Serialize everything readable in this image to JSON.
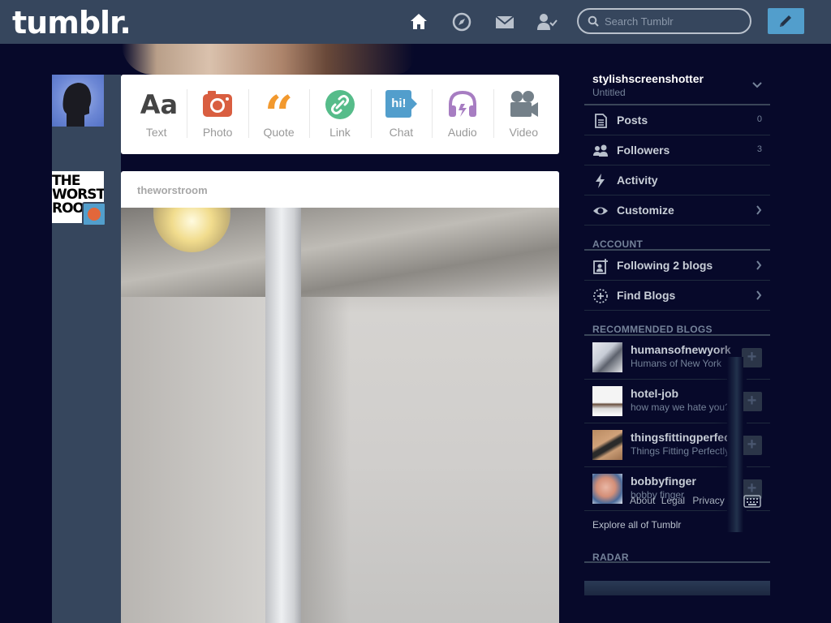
{
  "app": {
    "logo": "tumblr."
  },
  "search": {
    "placeholder": "Search Tumblr"
  },
  "nav": {
    "icons": [
      "home-icon",
      "compass-icon",
      "mail-icon",
      "account-icon"
    ],
    "compose_icon": "pencil-icon"
  },
  "post_types": [
    {
      "label": "Text",
      "glyph": "Aa",
      "color": "#444444"
    },
    {
      "label": "Photo",
      "color": "#d95e40"
    },
    {
      "label": "Quote",
      "glyph": "“",
      "color": "#f2992e"
    },
    {
      "label": "Link",
      "color": "#56bc8a"
    },
    {
      "label": "Chat",
      "glyph": "hi!",
      "color": "#529ecc"
    },
    {
      "label": "Audio",
      "color": "#a77dc2"
    },
    {
      "label": "Video",
      "color": "#748089"
    }
  ],
  "dashboard": {
    "avatar_blog_text": "THE WORST ROO",
    "post": {
      "blog_name": "theworstroom"
    }
  },
  "sidebar": {
    "username": "stylishscreenshotter",
    "subtitle": "Untitled",
    "items": [
      {
        "label": "Posts",
        "count": "0",
        "icon": "posts-icon"
      },
      {
        "label": "Followers",
        "count": "3",
        "icon": "followers-icon"
      },
      {
        "label": "Activity",
        "icon": "lightning-icon"
      },
      {
        "label": "Customize",
        "icon": "eye-icon"
      }
    ],
    "account_header": "ACCOUNT",
    "account_items": [
      {
        "label": "Following 2 blogs",
        "icon": "following-icon"
      },
      {
        "label": "Find Blogs",
        "icon": "find-blogs-icon"
      }
    ],
    "recommended_header": "RECOMMENDED BLOGS",
    "recommended": [
      {
        "name": "humansofnewyork",
        "desc": "Humans of New York"
      },
      {
        "name": "hotel-job",
        "desc": "how may we hate you?"
      },
      {
        "name": "thingsfittingperfectly",
        "desc": "Things Fitting Perfectly"
      },
      {
        "name": "bobbyfinger",
        "desc": "bobby finger"
      }
    ],
    "explore": "Explore all of Tumblr",
    "radar_header": "RADAR"
  },
  "footer": {
    "about": "About",
    "legal": "Legal",
    "privacy": "Privacy"
  },
  "colors": {
    "topbar": "#36465d",
    "background": "#07092a",
    "accent": "#529ecc"
  }
}
